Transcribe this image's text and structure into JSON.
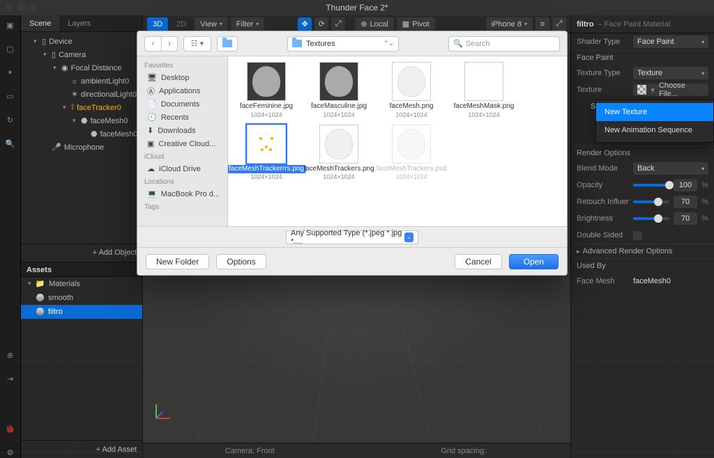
{
  "window_title": "Thunder Face 2*",
  "tabs": {
    "scene": "Scene",
    "layers": "Layers"
  },
  "scene": {
    "root": "Device",
    "camera": "Camera",
    "focal": "Focal Distance",
    "ambient": "ambientLight0",
    "dirlight": "directionalLight0",
    "tracker": "faceTracker0",
    "facemesh": "faceMesh0",
    "facemesh2": "faceMesh0",
    "mic": "Microphone"
  },
  "add_object": "+  Add Object",
  "assets": {
    "header": "Assets",
    "materials": "Materials",
    "smooth": "smooth",
    "filtro": "filtro",
    "add_asset": "+  Add Asset"
  },
  "vp": {
    "b3d": "3D",
    "b2d": "2D",
    "view": "View",
    "filter": "Filter",
    "local": "Local",
    "pivot": "Pivot",
    "device": "iPhone 8",
    "camera_label": "Camera: Front",
    "grid_label": "Grid spacing:"
  },
  "inspector": {
    "name": "filtro",
    "subtitle": "– Face Paint Material",
    "shader_lab": "Shader Type",
    "shader_val": "Face Paint",
    "sec_facepaint": "Face Paint",
    "tex_type_lab": "Texture Type",
    "tex_type_val": "Texture",
    "texture_lab": "Texture",
    "choose_file": "Choose File...",
    "smooth_tex": "SkinSmoothingTexture",
    "render_opts": "Render Options",
    "blend_lab": "Blend Mode",
    "blend_val": "Back",
    "opacity_lab": "Opacity",
    "opacity_val": "100",
    "retouch_lab": "Retouch Influence",
    "retouch_val": "70",
    "bright_lab": "Brightness",
    "bright_val": "70",
    "dbl_lab": "Double Sided",
    "adv": "Advanced Render Options",
    "usedby": "Used By",
    "facemesh_lab": "Face Mesh",
    "facemesh_val": "faceMesh0"
  },
  "ctx": {
    "new_tex": "New Texture",
    "new_anim": "New Animation Sequence"
  },
  "finder": {
    "folder": "Textures",
    "search_ph": "Search",
    "fav": "Favorites",
    "desktop": "Desktop",
    "apps": "Applications",
    "docs": "Documents",
    "recents": "Recents",
    "downloads": "Downloads",
    "cc": "Creative Cloud...",
    "icloud_grp": "iCloud",
    "icloud": "iCloud Drive",
    "loc_grp": "Locations",
    "mbp": "MacBook Pro d...",
    "tags_grp": "Tags",
    "files": [
      {
        "name": "faceFeminine.jpg",
        "dim": "1024×1024",
        "kind": "face"
      },
      {
        "name": "faceMasculine.jpg",
        "dim": "1024×1024",
        "kind": "face"
      },
      {
        "name": "faceMesh.png",
        "dim": "1024×1024",
        "kind": "mesh"
      },
      {
        "name": "faceMeshMask.png",
        "dim": "1024×1024",
        "kind": "mask"
      },
      {
        "name": "faceMeshTrackerrrs.png",
        "dim": "1024×1024",
        "kind": "track",
        "sel": true
      },
      {
        "name": "faceMeshTrackers.png",
        "dim": "1024×1024",
        "kind": "mesh"
      },
      {
        "name": "faceMeshTrackers.psd",
        "dim": "1024×1024",
        "kind": "mesh",
        "dis": true
      }
    ],
    "filetype": "Any Supported Type (*.jpeg *.jpg *....",
    "new_folder": "New Folder",
    "options": "Options",
    "cancel": "Cancel",
    "open": "Open"
  }
}
